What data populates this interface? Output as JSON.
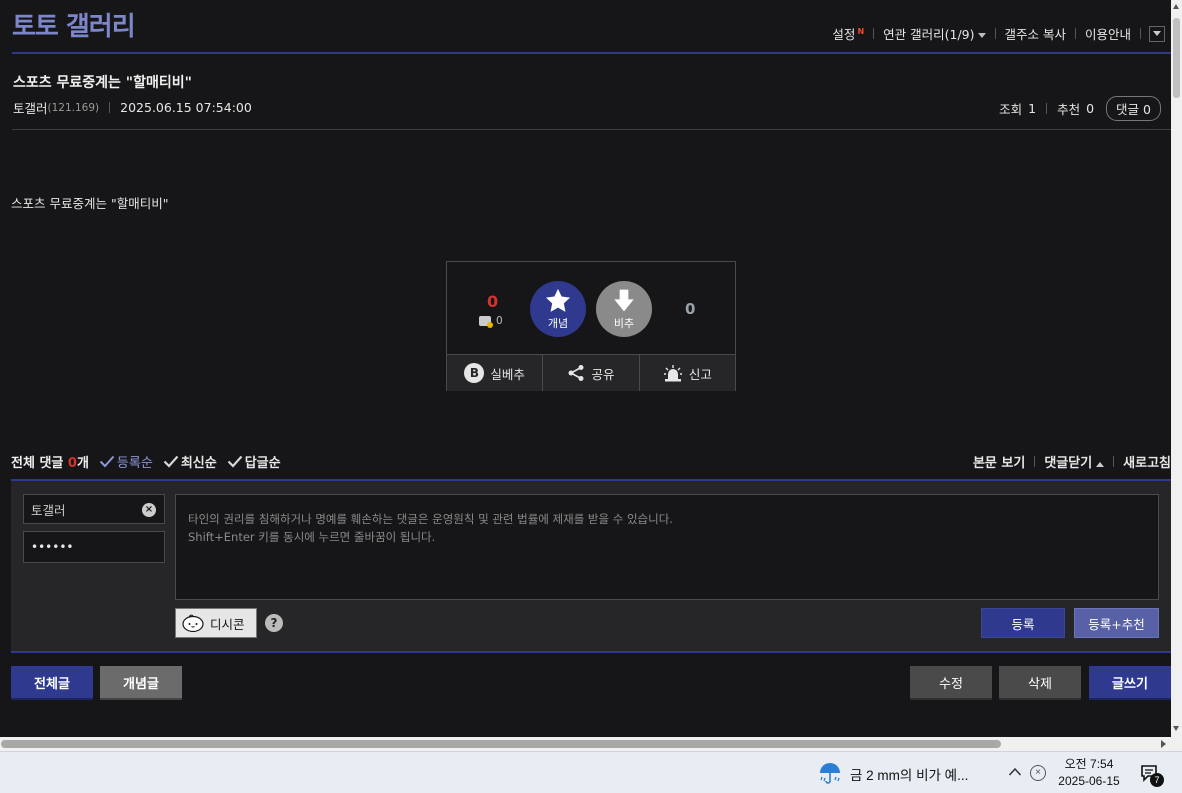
{
  "gallery": {
    "title": "토토 갤러리"
  },
  "top_links": {
    "settings": "설정",
    "settings_badge": "N",
    "related": "연관 갤러리(1/9)",
    "copy_address": "갤주소 복사",
    "guide": "이용안내"
  },
  "post": {
    "title": "스포츠 무료중계는 \"할매티비\"",
    "author": "토갤러",
    "ip": "(121.169)",
    "datetime": "2025.06.15 07:54:00",
    "views_label": "조회",
    "views": "1",
    "recommend_label": "추천",
    "recommend": "0",
    "comment_label": "댓글",
    "comment_count": "0",
    "body": "스포츠 무료중계는 \"할매티비\""
  },
  "recommend_box": {
    "up_count": "0",
    "fix_count": "0",
    "up_label": "개념",
    "down_label": "비추",
    "down_count": "0",
    "best_letter": "B",
    "best_label": "실베추",
    "share_label": "공유",
    "report_label": "신고"
  },
  "comments": {
    "total_prefix": "전체 댓글",
    "total_count": "0",
    "total_suffix": "개",
    "sort_register": "등록순",
    "sort_latest": "최신순",
    "sort_reply": "답글순",
    "view_body": "본문 보기",
    "close_comments": "댓글닫기",
    "refresh": "새로고침"
  },
  "comment_form": {
    "nickname": "토갤러",
    "password": "••••••",
    "notice_line1": "타인의 권리를 침해하거나 명예를 훼손하는 댓글은 운영원칙 및 관련 법률에 제재를 받을 수 있습니다.",
    "notice_line2": "Shift+Enter 키를 동시에 누르면 줄바꿈이 됩니다.",
    "dccon_label": "디시콘",
    "help": "?",
    "submit": "등록",
    "submit_recommend": "등록+추천"
  },
  "bottom_buttons": {
    "all_posts": "전체글",
    "concept_posts": "개념글",
    "edit": "수정",
    "delete": "삭제",
    "write": "글쓰기"
  },
  "taskbar": {
    "weather": "금 2 mm의 비가 예...",
    "time": "오전 7:54",
    "date": "2025-06-15",
    "notification_count": "7"
  },
  "colors": {
    "accent": "#2f3a8f",
    "title": "#7d86c8",
    "count_red": "#d4332b"
  }
}
